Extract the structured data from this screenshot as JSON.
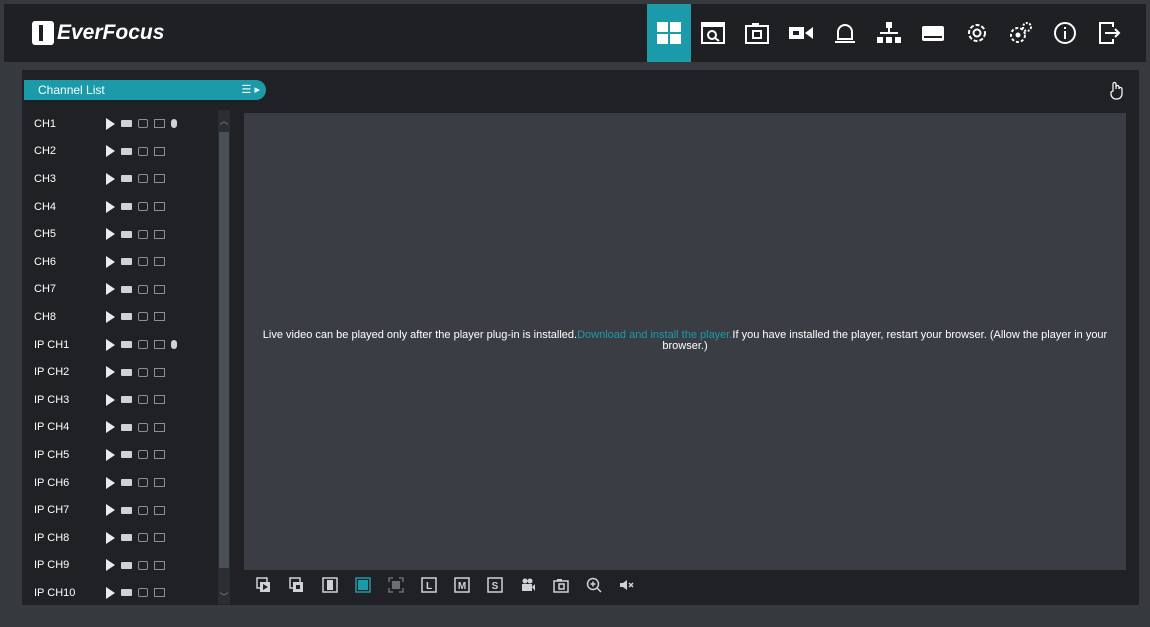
{
  "brand": {
    "name": "EverFocus"
  },
  "nav": [
    {
      "icon": "live-view-icon",
      "active": true
    },
    {
      "icon": "playback-icon"
    },
    {
      "icon": "snapshot-icon"
    },
    {
      "icon": "record-icon"
    },
    {
      "icon": "alarm-icon"
    },
    {
      "icon": "network-icon"
    },
    {
      "icon": "hdd-icon"
    },
    {
      "icon": "settings-icon"
    },
    {
      "icon": "advanced-settings-icon"
    },
    {
      "icon": "info-icon"
    },
    {
      "icon": "logout-icon"
    }
  ],
  "channel_list": {
    "title": "Channel List",
    "toggle": "☰ ▸",
    "channels": [
      {
        "name": "CH1",
        "mic": true
      },
      {
        "name": "CH2",
        "mic": false
      },
      {
        "name": "CH3",
        "mic": false
      },
      {
        "name": "CH4",
        "mic": false
      },
      {
        "name": "CH5",
        "mic": false
      },
      {
        "name": "CH6",
        "mic": false
      },
      {
        "name": "CH7",
        "mic": false
      },
      {
        "name": "CH8",
        "mic": false
      },
      {
        "name": "IP CH1",
        "mic": true
      },
      {
        "name": "IP CH2",
        "mic": false
      },
      {
        "name": "IP CH3",
        "mic": false
      },
      {
        "name": "IP CH4",
        "mic": false
      },
      {
        "name": "IP CH5",
        "mic": false
      },
      {
        "name": "IP CH6",
        "mic": false
      },
      {
        "name": "IP CH7",
        "mic": false
      },
      {
        "name": "IP CH8",
        "mic": false
      },
      {
        "name": "IP CH9",
        "mic": false
      },
      {
        "name": "IP CH10",
        "mic": false
      }
    ]
  },
  "video": {
    "msg_before": "Live video can be played only after the player plug-in is installed.",
    "msg_link": "Download and install the player.",
    "msg_after": "If you have installed the player, restart your browser. (Allow the player in your browser.)"
  },
  "toolbar": [
    {
      "icon": "start-all-icon"
    },
    {
      "icon": "stop-all-icon"
    },
    {
      "icon": "original-ratio-icon"
    },
    {
      "icon": "stretch-icon",
      "active": true
    },
    {
      "icon": "fullscreen-icon"
    },
    {
      "icon": "low-stream-icon",
      "label": "L"
    },
    {
      "icon": "main-stream-icon",
      "label": "M"
    },
    {
      "icon": "sub-stream-icon",
      "label": "S"
    },
    {
      "icon": "record-video-icon"
    },
    {
      "icon": "capture-icon"
    },
    {
      "icon": "zoom-in-icon"
    },
    {
      "icon": "mute-icon"
    }
  ],
  "colors": {
    "accent": "#1b9aaa",
    "bar": "#1e2023",
    "panel": "#1f2125",
    "video": "#3a3e44"
  }
}
